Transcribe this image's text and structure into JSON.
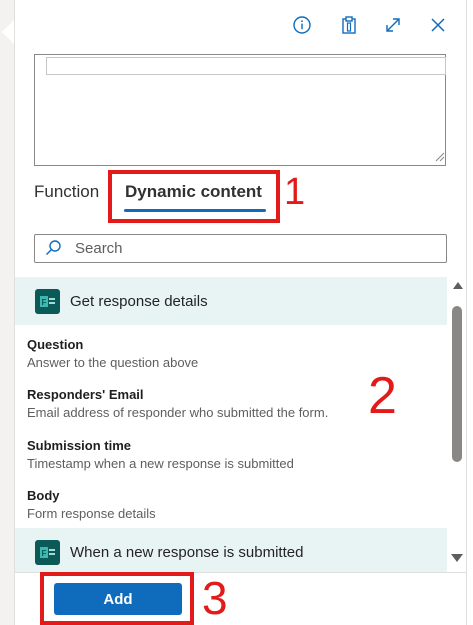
{
  "header": {
    "icons": [
      "info-icon",
      "clipboard-icon",
      "expand-icon",
      "close-icon"
    ]
  },
  "tabs": [
    {
      "label": "Function"
    },
    {
      "label": "Dynamic content"
    }
  ],
  "search": {
    "placeholder": "Search"
  },
  "groups": [
    {
      "title": "Get response details"
    },
    {
      "title": "When a new response is submitted"
    }
  ],
  "items": [
    {
      "title": "Question",
      "description": "Answer to the question above"
    },
    {
      "title": "Responders' Email",
      "description": "Email address of responder who submitted the form."
    },
    {
      "title": "Submission time",
      "description": "Timestamp when a new response is submitted"
    },
    {
      "title": "Body",
      "description": "Form response details"
    }
  ],
  "footer": {
    "add_label": "Add"
  },
  "annotations": {
    "n1": "1",
    "n2": "2",
    "n3": "3"
  },
  "colors": {
    "accent": "#0f6cbd",
    "annotation": "#e31a1a",
    "group_bg": "#e8f3f3",
    "forms_icon": "#0b5a58"
  }
}
